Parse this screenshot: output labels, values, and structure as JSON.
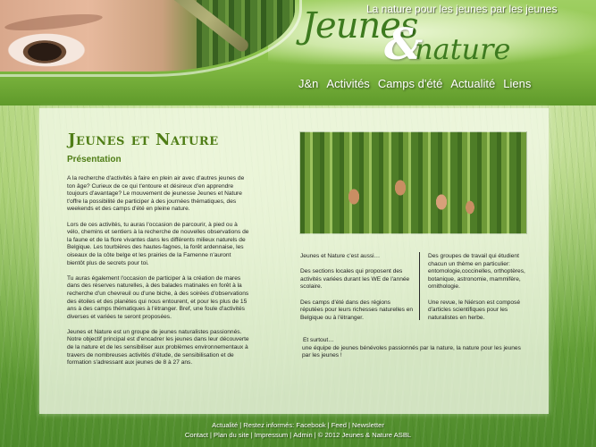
{
  "header": {
    "tagline": "La nature pour les jeunes par les jeunes",
    "logo": {
      "word1": "Jeunes",
      "amp": "&",
      "word2": "nature"
    }
  },
  "nav": {
    "items": [
      {
        "label": "J&n"
      },
      {
        "label": "Activités"
      },
      {
        "label": "Camps d'été"
      },
      {
        "label": "Actualité"
      },
      {
        "label": "Liens"
      }
    ]
  },
  "main": {
    "title": "Jeunes et Nature",
    "subtitle": "Présentation",
    "paragraphs": [
      "A la recherche d'activités à faire en plein air avec d'autres jeunes de ton âge? Curieux de ce qui t'entoure et désireux d'en apprendre toujours d'avantage? Le mouvement de jeunesse Jeunes et Nature t'offre la possibilité de participer à des journées thématiques, des weekends et des camps d'été en pleine nature.",
      "Lors de ces activités, tu auras l'occasion de parcourir, à pied ou à vélo, chemins et sentiers à la recherche de nouvelles observations de la faune et de la flore vivantes dans les différents milieux naturels de Belgique. Les tourbières des hautes-fagnes, la forêt ardennaise, les oiseaux de la côte belge et les prairies de la Famenne n'auront bientôt plus de secrets pour toi.",
      "Tu auras également l'occasion de participer à la création de mares dans des réserves naturelles, à des balades matinales en forêt à la recherche d'un chevreuil ou d'une biche, à des soirées d'observations des étoiles et des planètes qui nous entourent, et pour les plus de 15 ans à des camps thématiques à l'étranger. Bref, une foule d'activités diverses et variées te seront proposées.",
      "Jeunes et Nature est un groupe de jeunes naturalistes passionnés. Notre objectif principal est d'encadrer les jeunes dans leur découverte de la nature et de les sensibiliser aux problèmes environnementaux à travers de nombreuses activités d'étude, de sensibilisation et de formation s'adressant aux jeunes de 8 à 27 ans."
    ],
    "side": {
      "col_a": [
        "Jeunes et Nature c'est aussi…",
        "Des sections locales qui proposent des activités variées durant les WE de l'année scolaire.",
        "Des camps d'été dans des régions réputées pour leurs richesses naturelles en Belgique ou à l'étranger."
      ],
      "col_b": [
        "Des groupes de travail qui étudient chacun un thème en particulier: entomologie,coccinelles, orthoptères, botanique, astronomie, mammifère, ornithologie.",
        "Une revue, le Niérson est composé d'articles scientifiques pour les naturalistes en herbe."
      ],
      "et_surtout_lead": "Et surtout…",
      "et_surtout_text": "une équipe de jeunes bénévoles passionnés par la nature, la nature pour les jeunes par les jeunes !"
    }
  },
  "footer": {
    "line1": [
      {
        "label": "Actualité"
      },
      {
        "label": "Restez informés: Facebook"
      },
      {
        "label": "Feed"
      },
      {
        "label": "Newsletter"
      }
    ],
    "line2": [
      {
        "label": "Contact"
      },
      {
        "label": "Plan du site"
      },
      {
        "label": "Impressum"
      },
      {
        "label": "Admin"
      },
      {
        "label": "© 2012 Jeunes & Nature ASBL"
      }
    ]
  }
}
